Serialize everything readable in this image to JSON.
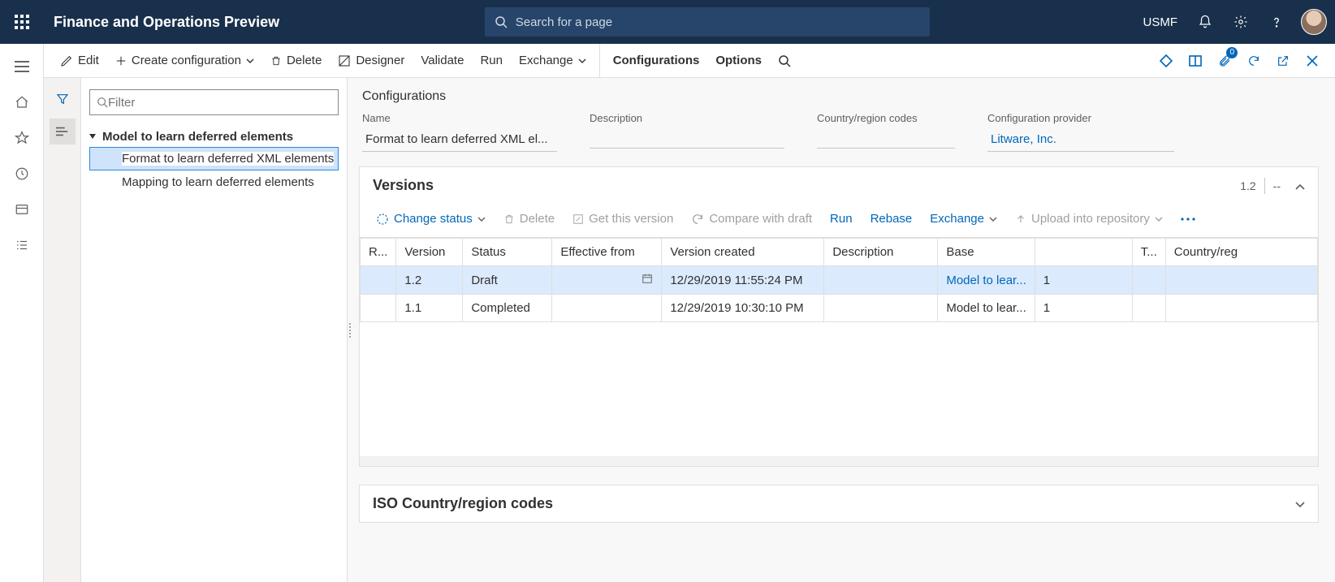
{
  "top": {
    "app_title": "Finance and Operations Preview",
    "search_placeholder": "Search for a page",
    "company": "USMF"
  },
  "cmdbar": {
    "edit": "Edit",
    "create_config": "Create configuration",
    "delete": "Delete",
    "designer": "Designer",
    "validate": "Validate",
    "run": "Run",
    "exchange": "Exchange",
    "configurations": "Configurations",
    "options": "Options",
    "attach_count": "0"
  },
  "tree": {
    "filter_placeholder": "Filter",
    "root": "Model to learn deferred elements",
    "children": [
      "Format to learn deferred XML elements",
      "Mapping to learn deferred elements"
    ]
  },
  "header": {
    "title": "Configurations",
    "labels": {
      "name": "Name",
      "description": "Description",
      "codes": "Country/region codes",
      "provider": "Configuration provider"
    },
    "values": {
      "name": "Format to learn deferred XML el...",
      "description": "",
      "codes": "",
      "provider": "Litware, Inc."
    }
  },
  "versions": {
    "title": "Versions",
    "current": "1.2",
    "dashes": "--",
    "actions": {
      "change_status": "Change status",
      "delete": "Delete",
      "get_this": "Get this version",
      "compare": "Compare with draft",
      "run": "Run",
      "rebase": "Rebase",
      "exchange": "Exchange",
      "upload": "Upload into repository"
    },
    "columns": [
      "R...",
      "Version",
      "Status",
      "Effective from",
      "Version created",
      "Description",
      "Base",
      "",
      "T...",
      "Country/reg"
    ],
    "rows": [
      {
        "version": "1.2",
        "status": "Draft",
        "effective": "",
        "created": "12/29/2019 11:55:24 PM",
        "desc": "",
        "base": "Model to lear...",
        "baseN": "1",
        "t": "",
        "cr": ""
      },
      {
        "version": "1.1",
        "status": "Completed",
        "effective": "",
        "created": "12/29/2019 10:30:10 PM",
        "desc": "",
        "base": "Model to lear...",
        "baseN": "1",
        "t": "",
        "cr": ""
      }
    ]
  },
  "iso_card": {
    "title": "ISO Country/region codes"
  }
}
